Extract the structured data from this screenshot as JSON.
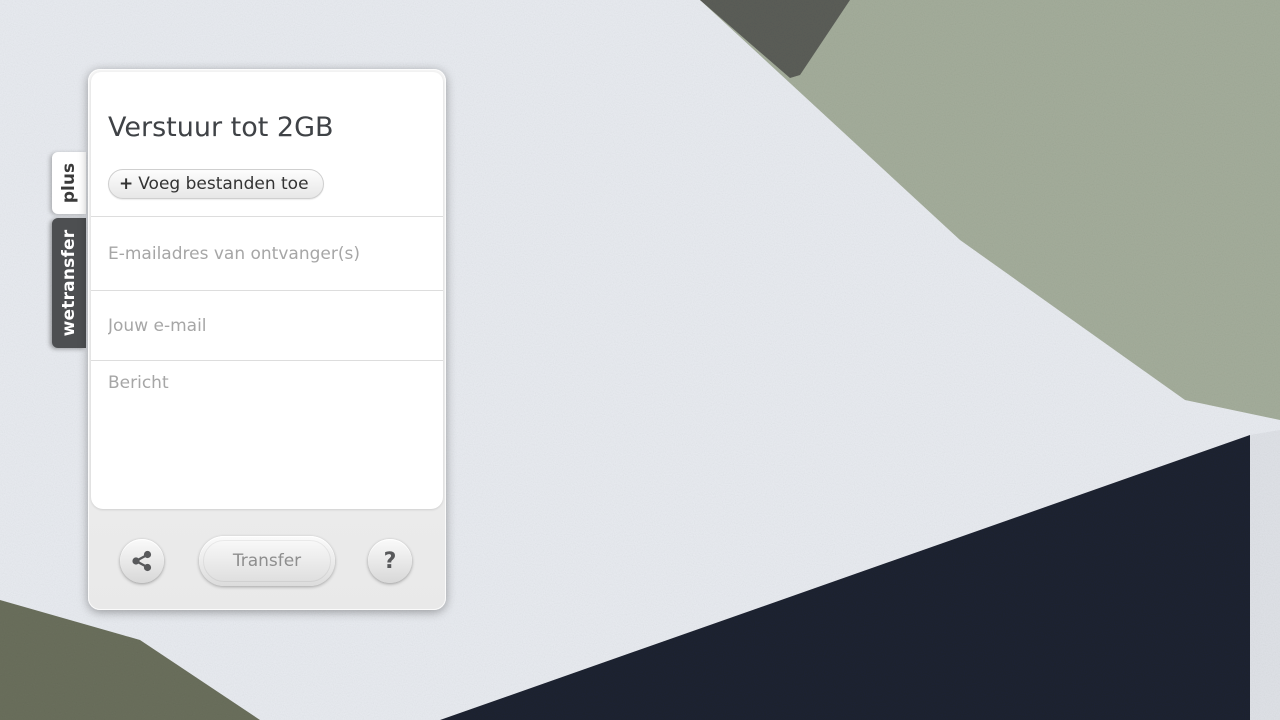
{
  "side_tabs": {
    "plus_label": "plus",
    "brand_label": "wetransfer"
  },
  "form": {
    "title": "Verstuur tot 2GB",
    "add_files_label": "Voeg bestanden toe",
    "add_files_prefix": "+",
    "recipients_placeholder": "E-mailadres van ontvanger(s)",
    "sender_placeholder": "Jouw e-mail",
    "message_placeholder": "Bericht"
  },
  "footer": {
    "transfer_label": "Transfer",
    "help_label": "?",
    "share_icon": "share-icon"
  },
  "colors": {
    "wall_white": "#e9ecf1",
    "wall_green": "#a4ad9b",
    "wall_navy": "#1e2230",
    "brand_tab": "#4d4f51"
  }
}
